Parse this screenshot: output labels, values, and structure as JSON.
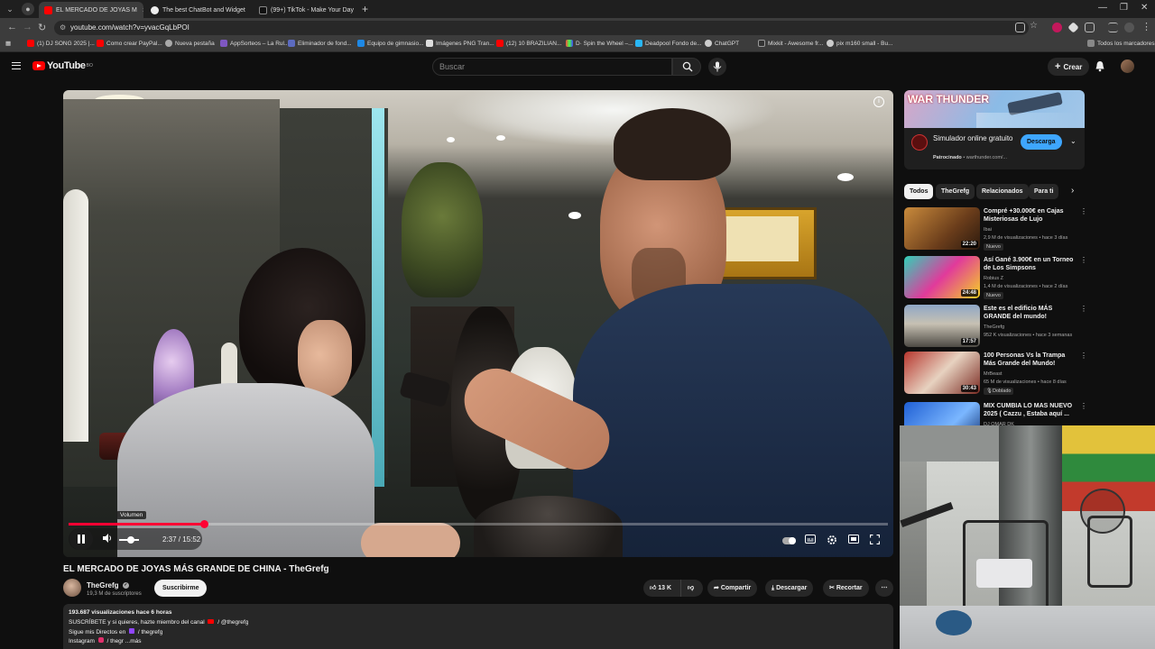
{
  "browser": {
    "tabs": [
      {
        "label": "EL MERCADO DE JOYAS M",
        "active": true
      },
      {
        "label": "The best ChatBot and Widget",
        "active": false
      },
      {
        "label": "(99+) TikTok - Make Your Day",
        "active": false
      }
    ],
    "url": "youtube.com/watch?v=yvacGqLbPOI",
    "bookmarks": [
      "(1) DJ SONG 2025 |...",
      "Como crear PayPal...",
      "Nueva pestaña",
      "AppSorteos – La Rul...",
      "Eliminador de fond...",
      "Equipo de gimnasio...",
      "Imágenes PNG Tran...",
      "(12) 10 BRAZILIAN...",
      "D· Spin the Wheel –...",
      "Deadpool Fondo de...",
      "ChatGPT",
      "Mixkit - Awesome fr...",
      "pix m160 small - Bu..."
    ],
    "all_bookmarks": "Todos los marcadores"
  },
  "header": {
    "logo_text": "YouTube",
    "logo_region": "BO",
    "search_placeholder": "Buscar",
    "create_label": "Crear"
  },
  "player": {
    "volume_tooltip": "Volumen",
    "current_time": "2:37",
    "duration": "15:52",
    "time_display": "2:37 / 15:52",
    "progress_fraction": 0.165
  },
  "video": {
    "title": "EL MERCADO DE JOYAS MÁS GRANDE DE CHINA - TheGrefg",
    "channel": "TheGrefg",
    "subscribers": "19,3 M de suscriptores",
    "subscribe_label": "Suscribirme",
    "likes": "13 K",
    "share_label": "Compartir",
    "download_label": "Descargar",
    "clip_label": "Recortar",
    "description": {
      "stats": "193.687 visualizaciones  hace 6 horas",
      "line1": "SUSCRÍBETE y si quieres, hazte miembro del canal",
      "line1_link": "/ @thegrefg",
      "line2": "Sigue mis Directos en",
      "line2_link": "/ thegrefg",
      "line3": "Instagram",
      "line3_link": "/ thegr",
      "more": "...más"
    }
  },
  "ad": {
    "banner_text": "WAR THUNDER",
    "title": "Simulador online gratuito",
    "sponsor_label": "Patrocinado",
    "sponsor_domain": "warthunder.com/...",
    "button_label": "Descarga"
  },
  "chips": [
    {
      "label": "Todos",
      "active": true
    },
    {
      "label": "TheGrefg",
      "active": false
    },
    {
      "label": "Relacionados",
      "active": false
    },
    {
      "label": "Para ti",
      "active": false
    }
  ],
  "recommendations": [
    {
      "title": "Compré +30.000€ en Cajas Misteriosas de Lujo",
      "channel": "Ibai",
      "meta": "2,9 M de visualizaciones • hace 3 días",
      "badge": "Nuevo",
      "duration": "22:20"
    },
    {
      "title": "Así Gané 3.900€ en un Torneo de Los Simpsons",
      "channel": "Robius Z",
      "meta": "1,4 M de visualizaciones • hace 2 días",
      "badge": "Nuevo",
      "duration": "24:48"
    },
    {
      "title": "Este es el edificio MÁS GRANDE del mundo!",
      "channel": "TheGrefg",
      "meta": "952 K visualizaciones • hace 3 semanas",
      "badge": "",
      "duration": "17:57"
    },
    {
      "title": "100 Personas Vs la Trampa Más Grande del Mundo!",
      "channel": "MrBeast",
      "meta": "65 M de visualizaciones • hace 8 días",
      "badge": "Doblado",
      "duration": "30:43"
    },
    {
      "title": "MIX CUMBIA LO MAS NUEVO 2025 ( Cazzu , Estaba aquí ...",
      "channel": "DJ OMAR DK",
      "meta": "",
      "badge": "",
      "duration": ""
    }
  ],
  "colors": {
    "youtube_red": "#ff0000",
    "progress_red": "#ff0033",
    "ad_button_blue": "#3ea6ff",
    "background": "#0f0f0f"
  }
}
